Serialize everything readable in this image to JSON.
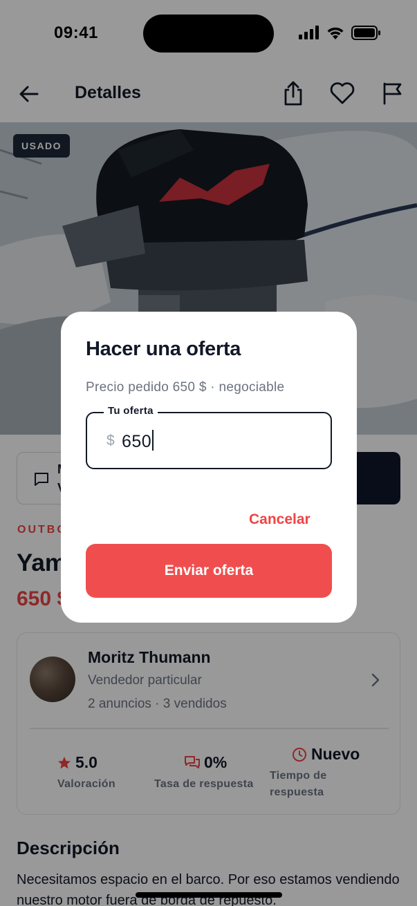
{
  "status_bar": {
    "time": "09:41"
  },
  "header": {
    "title": "Detalles"
  },
  "photo": {
    "badge": "USADO"
  },
  "actions": {
    "message_label": "M",
    "message_sub": "V"
  },
  "listing": {
    "category": "OUTBO",
    "title": "Yam",
    "price": "650 $"
  },
  "seller": {
    "name": "Moritz Thumann",
    "type": "Vendedor particular",
    "stats": "2 anuncios · 3 vendidos",
    "rating_value": "5.0",
    "rating_label": "Valoración",
    "response_rate_value": "0%",
    "response_rate_label": "Tasa de respuesta",
    "response_time_value": "Nuevo",
    "response_time_label": "Tiempo de respuesta"
  },
  "description": {
    "title": "Descripción",
    "text": "Necesitamos espacio en el barco. Por eso estamos vendiendo nuestro motor fuera de borda de repuesto."
  },
  "offer_modal": {
    "title": "Hacer una oferta",
    "asking_price": "Precio pedido 650 $ · negociable",
    "field_label": "Tu oferta",
    "currency": "$",
    "value": "650",
    "cancel_label": "Cancelar",
    "submit_label": "Enviar oferta"
  },
  "colors": {
    "accent": "#F04E4E",
    "dark": "#0F172A"
  }
}
